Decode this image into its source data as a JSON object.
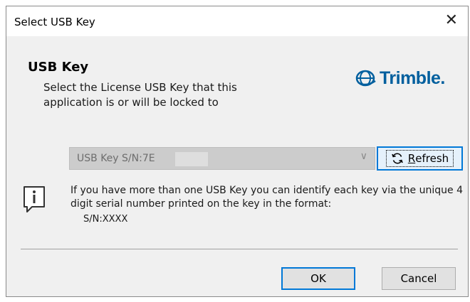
{
  "window": {
    "title": "Select USB Key",
    "close_glyph": "✕"
  },
  "header": {
    "heading": "USB Key",
    "description": "Select the License USB Key that this application is or will be locked to",
    "logo_text": "Trimble.",
    "logo_icon": "trimble-globe-icon",
    "brand_color": "#005f9e"
  },
  "usb_select": {
    "selected_value": "USB Key S/N:7E",
    "arrow_glyph": "∨",
    "disabled": true
  },
  "refresh_button": {
    "label_first": "R",
    "label_rest": "efresh",
    "icon": "refresh-icon",
    "accent": "#0078d7"
  },
  "info": {
    "icon": "info-icon",
    "text": "If you have more than one USB Key you can identify each key via the unique 4 digit serial number printed on the key in the format:",
    "format": "S/N:XXXX"
  },
  "footer": {
    "ok_label": "OK",
    "cancel_label": "Cancel"
  }
}
